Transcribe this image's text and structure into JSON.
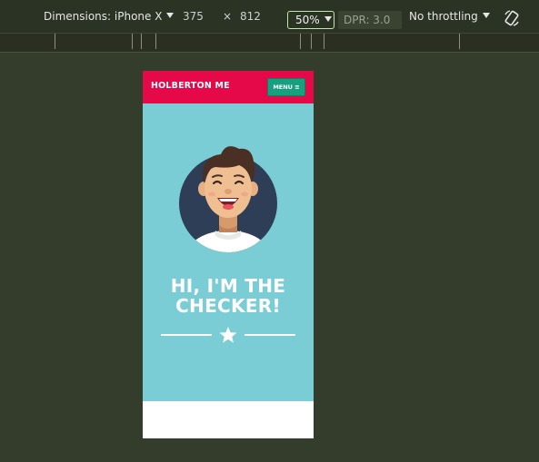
{
  "toolbar": {
    "dimensions_label": "Dimensions: iPhone X",
    "width": "375",
    "times": "×",
    "height": "812",
    "zoom": "50%",
    "dpr": "DPR: 3.0",
    "throttling": "No throttling",
    "rotate_icon": "rotate-icon"
  },
  "phone": {
    "brand": "HOLBERTON ME",
    "menu_label": "MENU ≡",
    "title_line1": "HI, I'M THE",
    "title_line2": "CHECKER!",
    "divider_icon": "star-icon"
  },
  "colors": {
    "header": "#e5094a",
    "menu": "#17a07d",
    "hero": "#7acdd4",
    "avatar_bg": "#2e3e57"
  }
}
